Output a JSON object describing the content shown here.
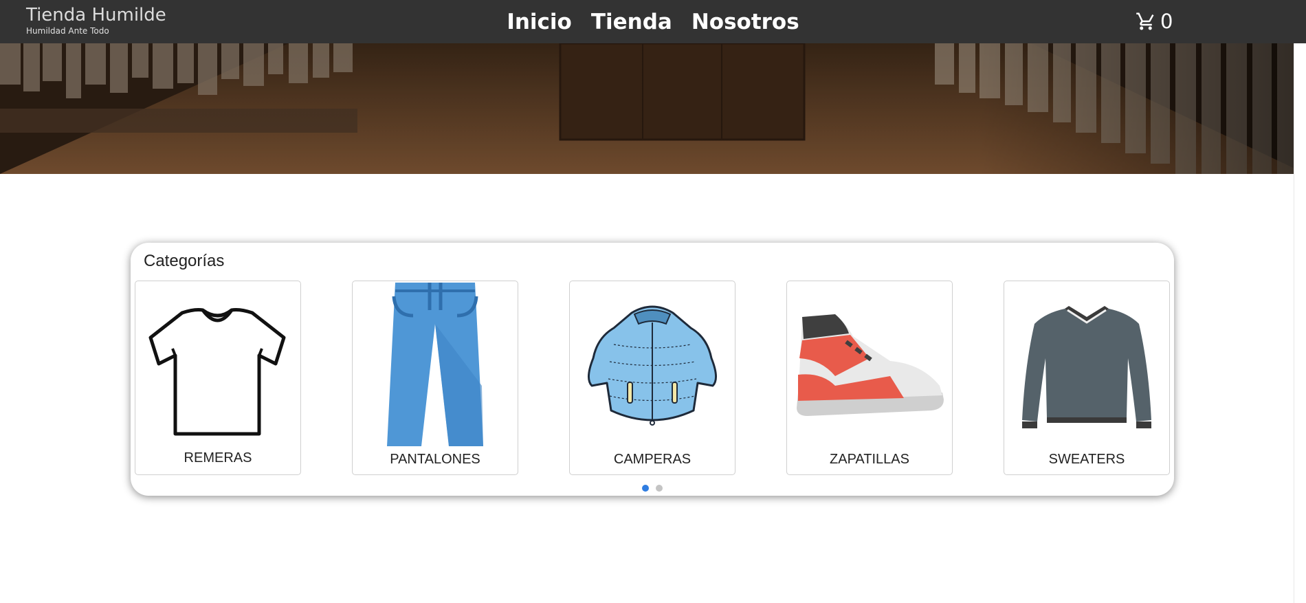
{
  "header": {
    "brand_name": "Tienda Humilde",
    "brand_tagline": "Humildad Ante Todo",
    "nav": [
      {
        "label": "Inicio"
      },
      {
        "label": "Tienda"
      },
      {
        "label": "Nosotros"
      }
    ],
    "cart": {
      "icon": "cart-icon",
      "count": "0"
    }
  },
  "hero": {
    "image": "clothing-store-interior"
  },
  "categories": {
    "title": "Categorías",
    "items": [
      {
        "label": "REMERAS",
        "icon": "t-shirt-icon"
      },
      {
        "label": "PANTALONES",
        "icon": "jeans-icon"
      },
      {
        "label": "CAMPERAS",
        "icon": "puffer-jacket-icon"
      },
      {
        "label": "ZAPATILLAS",
        "icon": "sneaker-icon"
      },
      {
        "label": "SWEATERS",
        "icon": "sweater-icon"
      }
    ],
    "pagination": {
      "pages": 2,
      "active_page": 1
    }
  },
  "colors": {
    "navbar": "#333333",
    "active_dot": "#2f7de1",
    "inactive_dot": "#c4c4c4"
  }
}
